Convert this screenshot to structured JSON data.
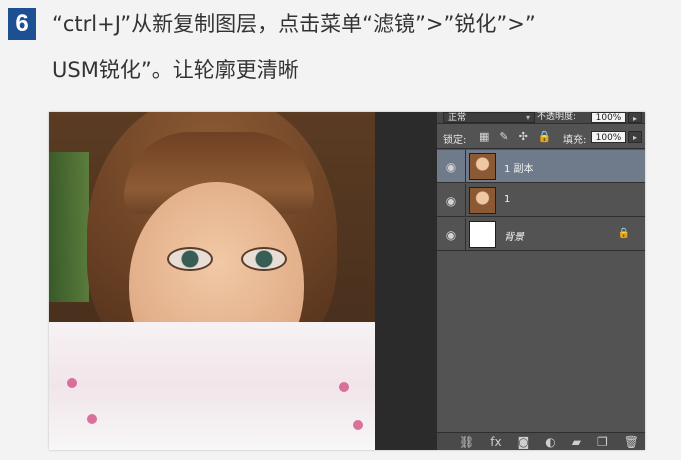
{
  "step_number": "6",
  "instruction_line1": "“ctrl+J”从新复制图层，点击菜单“滤镜”>”锐化”>”",
  "instruction_line2": "USM锐化”。让轮廓更清晰",
  "layers_panel": {
    "blend_mode": "正常",
    "opacity_label": "不透明度:",
    "opacity_value": "100%",
    "lock_label": "锁定:",
    "fill_label": "填充:",
    "fill_value": "100%",
    "layers": [
      {
        "name": "1 副本",
        "active": true,
        "icon": "photo-thumbnail"
      },
      {
        "name": "1",
        "active": false,
        "icon": "photo-thumbnail"
      },
      {
        "name": "背景",
        "active": false,
        "icon": "white-thumbnail",
        "locked": true
      }
    ],
    "footer_icons": [
      "link-icon",
      "fx-icon",
      "mask-icon",
      "adjustment-icon",
      "folder-icon",
      "new-layer-icon",
      "trash-icon"
    ]
  }
}
